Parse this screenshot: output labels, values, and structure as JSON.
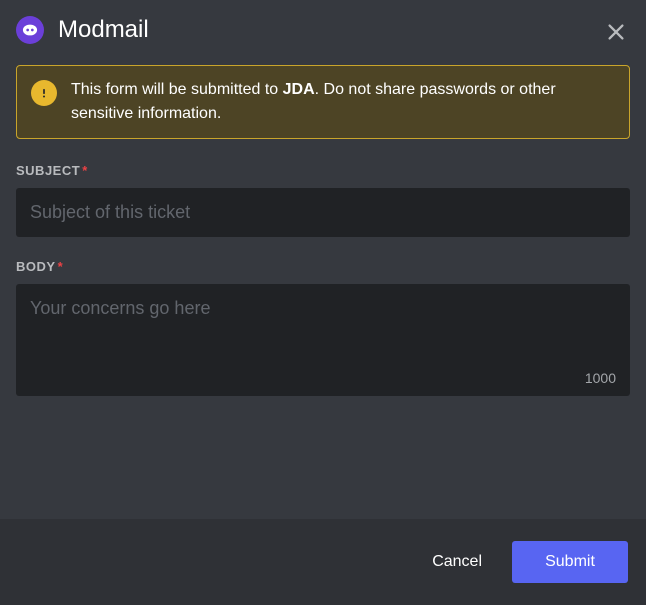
{
  "header": {
    "title": "Modmail"
  },
  "warning": {
    "text_before": "This form will be submitted to ",
    "bold": "JDA",
    "text_after": ". Do not share passwords or other sensitive information."
  },
  "fields": {
    "subject": {
      "label": "Subject",
      "placeholder": "Subject of this ticket",
      "value": ""
    },
    "body": {
      "label": "Body",
      "placeholder": "Your concerns go here",
      "value": "",
      "char_remaining": "1000"
    }
  },
  "footer": {
    "cancel": "Cancel",
    "submit": "Submit"
  }
}
